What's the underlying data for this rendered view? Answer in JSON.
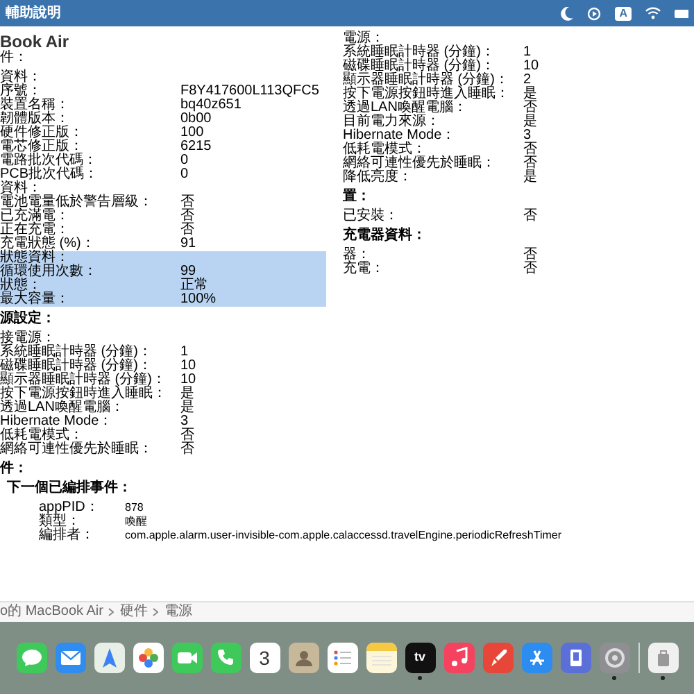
{
  "menu_bar": {
    "title": "輔助說明",
    "input_source": "A"
  },
  "columns": [
    {
      "lines": [
        {
          "kind": "title",
          "text": "Book Air",
          "highlighted": false
        },
        {
          "kind": "text",
          "text": "件：",
          "highlighted": false
        },
        {
          "kind": "gap"
        },
        {
          "kind": "text",
          "text": "資料：",
          "highlighted": false
        },
        {
          "kind": "row",
          "label": "序號：",
          "value": "F8Y417600L113QFC5",
          "highlighted": false
        },
        {
          "kind": "row",
          "label": "裝置名稱：",
          "value": "bq40z651",
          "highlighted": false
        },
        {
          "kind": "row",
          "label": "韌體版本：",
          "value": "0b00",
          "highlighted": false
        },
        {
          "kind": "row",
          "label": "硬件修正版：",
          "value": "100",
          "highlighted": false
        },
        {
          "kind": "row",
          "label": "電芯修正版：",
          "value": "6215",
          "highlighted": false
        },
        {
          "kind": "row",
          "label": "電路批次代碼：",
          "value": "0",
          "highlighted": false
        },
        {
          "kind": "row",
          "label": "PCB批次代碼：",
          "value": "0",
          "highlighted": false
        },
        {
          "kind": "text",
          "text": "資料：",
          "highlighted": false
        },
        {
          "kind": "row",
          "label": "電池電量低於警告層級：",
          "value": "否",
          "highlighted": false
        },
        {
          "kind": "row",
          "label": "已充滿電：",
          "value": "否",
          "highlighted": false
        },
        {
          "kind": "row",
          "label": "正在充電：",
          "value": "否",
          "highlighted": false
        },
        {
          "kind": "row",
          "label": "充電狀態 (%)：",
          "value": "91",
          "highlighted": false
        },
        {
          "kind": "text",
          "text": "狀態資料：",
          "highlighted": true
        },
        {
          "kind": "row",
          "label": "循環使用次數：",
          "value": "99",
          "highlighted": true
        },
        {
          "kind": "row",
          "label": "狀態：",
          "value": "正常",
          "highlighted": true
        },
        {
          "kind": "row",
          "label": "最大容量：",
          "value": "100%",
          "highlighted": true
        },
        {
          "kind": "gap"
        },
        {
          "kind": "heading",
          "text": "源設定：",
          "highlighted": false
        },
        {
          "kind": "gap"
        },
        {
          "kind": "text",
          "text": "接電源：",
          "highlighted": false
        },
        {
          "kind": "row",
          "label": "系統睡眠計時器 (分鐘)：",
          "value": "1",
          "highlighted": false
        },
        {
          "kind": "row",
          "label": "磁碟睡眠計時器 (分鐘)：",
          "value": "10",
          "highlighted": false
        },
        {
          "kind": "row",
          "label": "顯示器睡眠計時器 (分鐘)：",
          "value": "10",
          "highlighted": false
        },
        {
          "kind": "row",
          "label": "按下電源按鈕時進入睡眠：",
          "value": "是",
          "highlighted": false
        },
        {
          "kind": "row",
          "label": "透過LAN喚醒電腦：",
          "value": "是",
          "highlighted": false
        },
        {
          "kind": "row",
          "label": "Hibernate Mode：",
          "value": "3",
          "highlighted": false
        },
        {
          "kind": "row",
          "label": "低耗電模式：",
          "value": "否",
          "highlighted": false
        },
        {
          "kind": "row",
          "label": "網絡可連性優先於睡眠：",
          "value": "否",
          "highlighted": false
        }
      ]
    },
    {
      "lines": [
        {
          "kind": "text",
          "text": "電源：",
          "highlighted": false
        },
        {
          "kind": "row",
          "label": "系統睡眠計時器 (分鐘)：",
          "value": "1",
          "highlighted": false
        },
        {
          "kind": "row",
          "label": "磁碟睡眠計時器 (分鐘)：",
          "value": "10",
          "highlighted": false
        },
        {
          "kind": "row",
          "label": "顯示器睡眠計時器 (分鐘)：",
          "value": "2",
          "highlighted": false
        },
        {
          "kind": "row",
          "label": "按下電源按鈕時進入睡眠：",
          "value": "是",
          "highlighted": false
        },
        {
          "kind": "row",
          "label": "透過LAN喚醒電腦：",
          "value": "否",
          "highlighted": false
        },
        {
          "kind": "row",
          "label": "目前電力來源：",
          "value": "是",
          "highlighted": false
        },
        {
          "kind": "row",
          "label": "Hibernate Mode：",
          "value": "3",
          "highlighted": false
        },
        {
          "kind": "row",
          "label": "低耗電模式：",
          "value": "否",
          "highlighted": false
        },
        {
          "kind": "row",
          "label": "網絡可連性優先於睡眠：",
          "value": "否",
          "highlighted": false
        },
        {
          "kind": "row",
          "label": "降低亮度：",
          "value": "是",
          "highlighted": false
        },
        {
          "kind": "gap"
        },
        {
          "kind": "heading",
          "text": "置：",
          "highlighted": false
        },
        {
          "kind": "gap"
        },
        {
          "kind": "row",
          "label": "已安裝：",
          "value": "否",
          "highlighted": false
        },
        {
          "kind": "gap"
        },
        {
          "kind": "heading",
          "text": "充電器資料：",
          "highlighted": false
        },
        {
          "kind": "gap"
        },
        {
          "kind": "row",
          "label": "器：",
          "value": "否",
          "highlighted": false
        },
        {
          "kind": "row",
          "label": "充電：",
          "value": "否",
          "highlighted": false
        }
      ]
    }
  ],
  "events": {
    "heading": "件：",
    "subheading": "下一個已編排事件：",
    "rows": [
      {
        "label": "appPID：",
        "value": "878"
      },
      {
        "label": "類型：",
        "value": "喚醒"
      },
      {
        "label": "編排者：",
        "value": "com.apple.alarm.user-invisible-com.apple.calaccessd.travelEngine.periodicRefreshTimer"
      }
    ]
  },
  "path_bar": [
    "o的 MacBook Air",
    "硬件",
    "電源"
  ],
  "dock": [
    {
      "kind": "messages",
      "running": false
    },
    {
      "kind": "mail",
      "running": false
    },
    {
      "kind": "maps",
      "running": false
    },
    {
      "kind": "photos",
      "running": false
    },
    {
      "kind": "facetime",
      "running": false
    },
    {
      "kind": "phone",
      "running": false
    },
    {
      "kind": "calendar",
      "text": "3",
      "running": false
    },
    {
      "kind": "contacts",
      "running": false
    },
    {
      "kind": "reminders",
      "running": false
    },
    {
      "kind": "notes",
      "running": false
    },
    {
      "kind": "tv",
      "text": "tv",
      "running": true
    },
    {
      "kind": "music",
      "running": false
    },
    {
      "kind": "launchpad",
      "running": false
    },
    {
      "kind": "appstore",
      "running": false
    },
    {
      "kind": "files",
      "running": false
    },
    {
      "kind": "settings",
      "running": true
    },
    {
      "kind": "separator"
    },
    {
      "kind": "utility",
      "running": true
    }
  ]
}
